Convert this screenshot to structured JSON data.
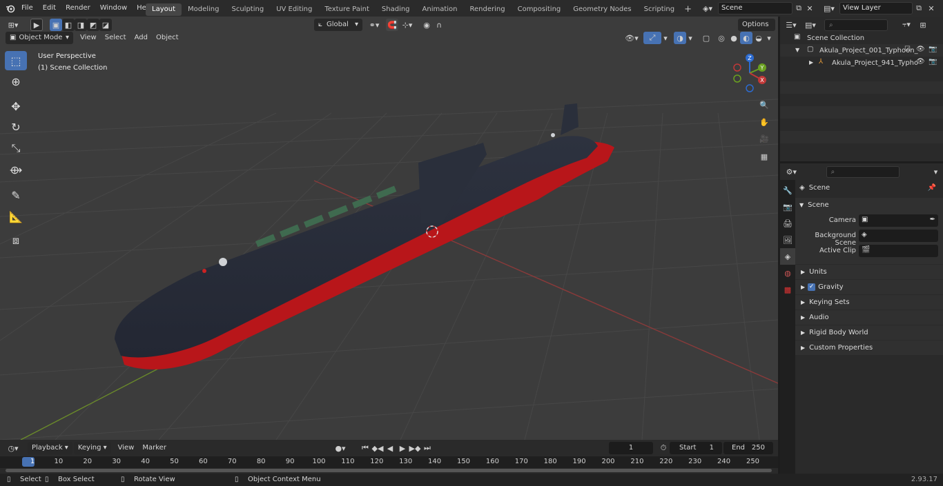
{
  "menu": {
    "items": [
      "File",
      "Edit",
      "Render",
      "Window",
      "Help"
    ]
  },
  "workspaces": [
    "Layout",
    "Modeling",
    "Sculpting",
    "UV Editing",
    "Texture Paint",
    "Shading",
    "Animation",
    "Rendering",
    "Compositing",
    "Geometry Nodes",
    "Scripting"
  ],
  "scene_field": "Scene",
  "view_layer_field": "View Layer",
  "viewport": {
    "mode": "Object Mode",
    "menus": [
      "View",
      "Select",
      "Add",
      "Object"
    ],
    "transform_orientation": "Global",
    "options_label": "Options",
    "overlay_line1": "User Perspective",
    "overlay_line2": "(1) Scene Collection",
    "axis_x": "X",
    "axis_y": "Y",
    "axis_z": "Z"
  },
  "outliner": {
    "root": "Scene Collection",
    "items": [
      {
        "label": "Akula_Project_001_Typhoon_"
      },
      {
        "label": "Akula_Project_941_Typho"
      }
    ]
  },
  "properties": {
    "context": "Scene",
    "section_title": "Scene",
    "camera_label": "Camera",
    "bg_scene_label": "Background Scene",
    "active_clip_label": "Active Clip",
    "subpanels": [
      "Units",
      "Gravity",
      "Keying Sets",
      "Audio",
      "Rigid Body World",
      "Custom Properties"
    ]
  },
  "timeline": {
    "menus": [
      "Playback",
      "Keying",
      "View",
      "Marker"
    ],
    "current_frame": "1",
    "start_label": "Start",
    "start_value": "1",
    "end_label": "End",
    "end_value": "250",
    "ruler": [
      "1",
      "10",
      "20",
      "30",
      "40",
      "50",
      "60",
      "70",
      "80",
      "90",
      "100",
      "110",
      "120",
      "130",
      "140",
      "150",
      "160",
      "170",
      "180",
      "190",
      "200",
      "210",
      "220",
      "230",
      "240",
      "250"
    ]
  },
  "statusbar": {
    "select": "Select",
    "box_select": "Box Select",
    "rotate_view": "Rotate View",
    "context_menu": "Object Context Menu",
    "version": "2.93.17"
  }
}
